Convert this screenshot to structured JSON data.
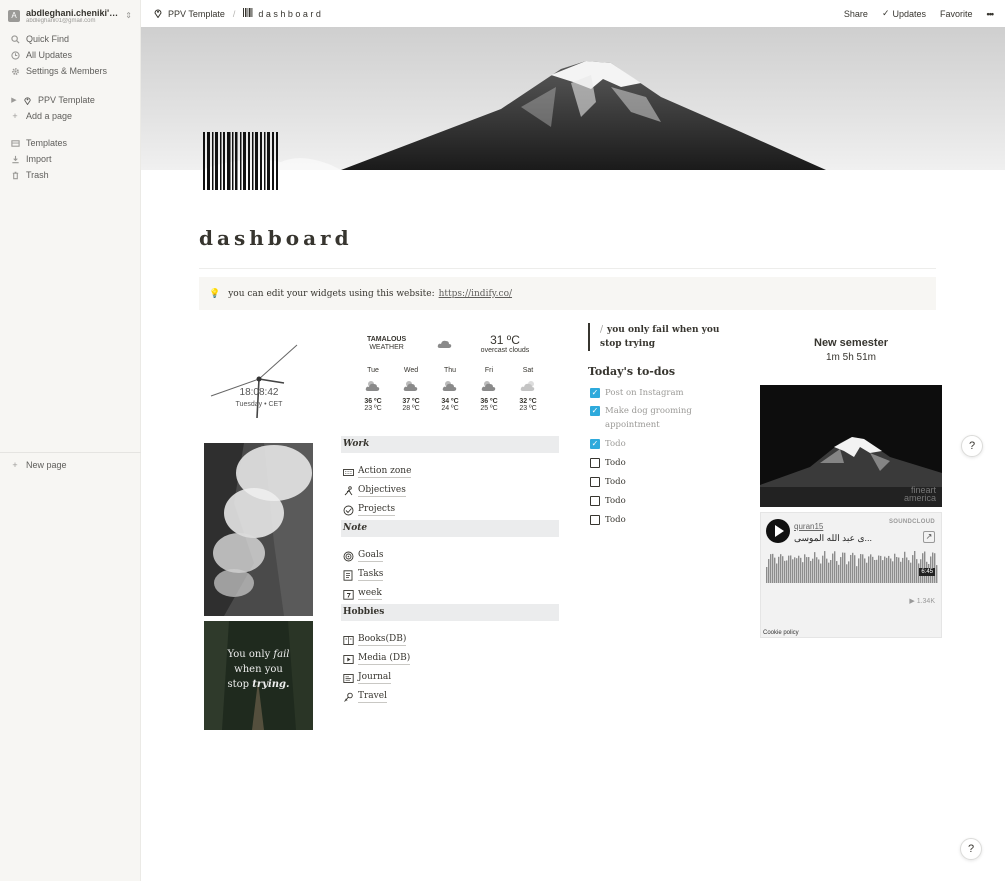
{
  "sidebar": {
    "workspace_name": "abdleghani.cheniki's No...",
    "workspace_email": "abdleghani01@gmail.com",
    "workspace_initial": "A",
    "quick_find": "Quick Find",
    "all_updates": "All Updates",
    "settings": "Settings & Members",
    "page_ppv": "PPV Template",
    "add_page": "Add a page",
    "templates": "Templates",
    "import": "Import",
    "trash": "Trash",
    "new_page": "New page"
  },
  "topbar": {
    "crumb_parent": "PPV Template",
    "crumb_sep": "/",
    "crumb_current": "d a s h b o a r d",
    "share": "Share",
    "updates": "Updates",
    "favorite": "Favorite",
    "more": "•••"
  },
  "page": {
    "title": "dashboard",
    "callout_text": "you can edit your widgets using this website:",
    "callout_link": "https://indify.co/"
  },
  "clock": {
    "time": "18:08:42",
    "date": "Tuesday • CET"
  },
  "weather": {
    "city": "TAMALOUS",
    "label": "WEATHER",
    "temp": "31 ºC",
    "desc": "overcast clouds",
    "days": [
      {
        "name": "Tue",
        "hi": "36 ºC",
        "lo": "23 ºC"
      },
      {
        "name": "Wed",
        "hi": "37 ºC",
        "lo": "28 ºC"
      },
      {
        "name": "Thu",
        "hi": "34 ºC",
        "lo": "24 ºC"
      },
      {
        "name": "Fri",
        "hi": "36 ºC",
        "lo": "25 ºC"
      },
      {
        "name": "Sat",
        "hi": "32 ºC",
        "lo": "23 ºC"
      }
    ]
  },
  "quote": {
    "slash": "/",
    "text": "you only fail when you stop trying"
  },
  "todos": {
    "heading": "Today's to-dos",
    "items": [
      {
        "label": "Post on Instagram",
        "checked": true
      },
      {
        "label": "Make dog grooming appointment",
        "checked": true
      },
      {
        "label": "Todo",
        "checked": true
      },
      {
        "label": "Todo",
        "checked": false
      },
      {
        "label": "Todo",
        "checked": false
      },
      {
        "label": "Todo",
        "checked": false
      },
      {
        "label": "Todo",
        "checked": false
      }
    ]
  },
  "countdown": {
    "title": "New semester",
    "time": "1m 5h 51m"
  },
  "fineart": {
    "line1": "fineart",
    "line2": "america"
  },
  "soundcloud": {
    "user": "quran15",
    "track": "...ى عبد الله الموسى",
    "brand": "SOUNDCLOUD",
    "duration": "6:45",
    "plays": "▶ 1.34K",
    "cookie": "Cookie policy"
  },
  "forest_quote": {
    "l1": "You only",
    "l1i": "fail",
    "l2": "when you",
    "l3": "stop",
    "l3i": "trying."
  },
  "groups": {
    "work": "Work",
    "note": "Note",
    "hobbies": "Hobbies"
  },
  "nav": {
    "action_zone": "Action zone",
    "objectives": "Objectives",
    "projects": "Projects",
    "goals": "Goals",
    "tasks": "Tasks",
    "week": "week",
    "books": "Books(DB)",
    "media": "Media (DB)",
    "journal": "Journal",
    "travel": "Travel"
  },
  "help": "?"
}
